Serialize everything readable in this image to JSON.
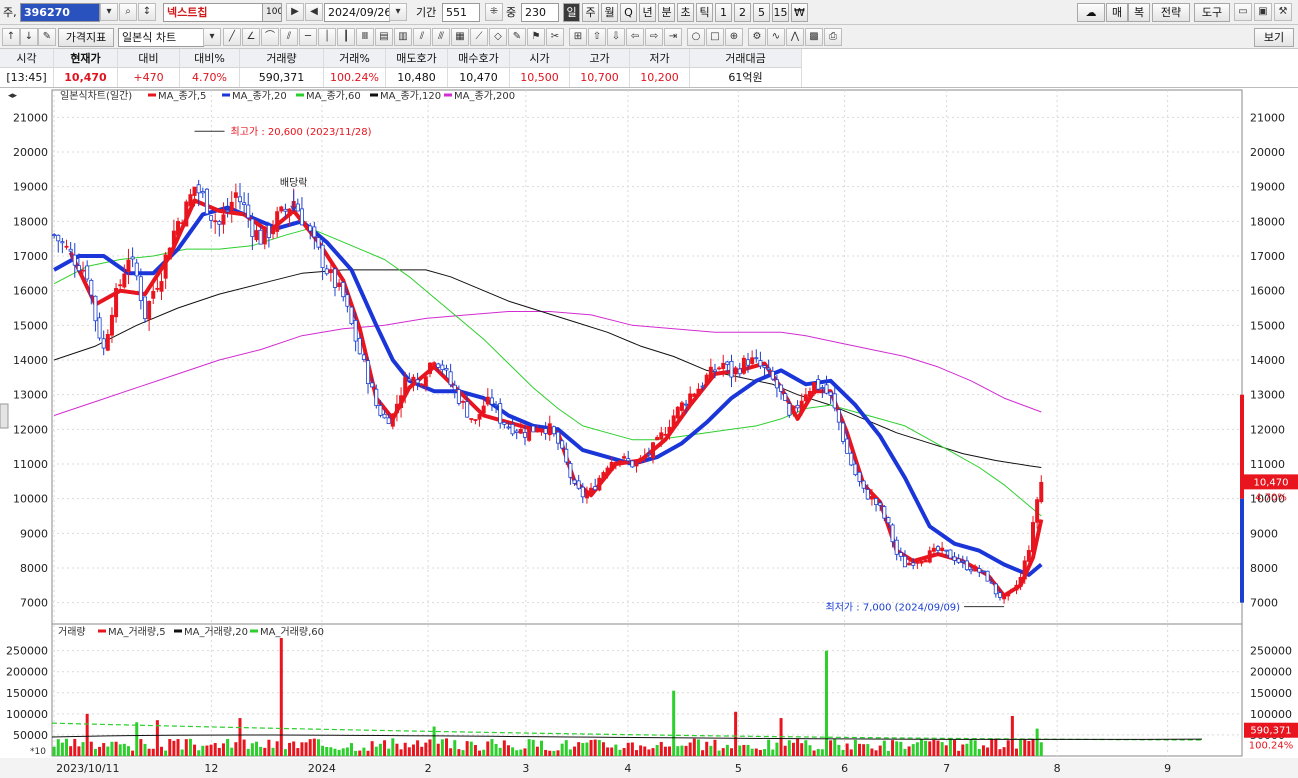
{
  "toolbar": {
    "code_prefix": "주,",
    "code_value": "396270",
    "name": "넥스트칩",
    "name_badge": "100",
    "date": "2024/09/26",
    "period_label": "기간",
    "period_value": "551",
    "zoom_label": "중",
    "zoom_value": "230",
    "intervals": [
      "일",
      "주",
      "월",
      "Q",
      "년",
      "분",
      "초",
      "틱",
      "1",
      "2",
      "5",
      "15",
      "₩"
    ],
    "right_buttons": [
      "매",
      "복",
      "전략",
      "도구"
    ],
    "indicator_button": "가격지표",
    "chart_type": "일본식 차트",
    "view_button": "보기"
  },
  "quote": {
    "headers": [
      "시각",
      "현재가",
      "대비",
      "대비%",
      "거래량",
      "거래%",
      "매도호가",
      "매수호가",
      "시가",
      "고가",
      "저가",
      "거래대금"
    ],
    "values": [
      "[13:45]",
      "10,470",
      "+470",
      "4.70%",
      "590,371",
      "100.24%",
      "10,480",
      "10,470",
      "10,500",
      "10,700",
      "10,200",
      "61억원"
    ]
  },
  "colors": {
    "up": "#e8141e",
    "down": "#1a3fd1",
    "ma5": "#e8141e",
    "ma20": "#1a35d8",
    "ma60": "#2ccf2c",
    "ma120": "#111111",
    "ma200": "#d22cd2",
    "vol_ma5": "#e8141e",
    "vol_ma20": "#111111",
    "vol_ma60": "#2ccf2c"
  },
  "chart_data": {
    "type": "candlestick",
    "title": "일본식차트(일간)",
    "legend": [
      "MA_종가,5",
      "MA_종가,20",
      "MA_종가,60",
      "MA_종가,120",
      "MA_종가,200"
    ],
    "ylim": [
      6500,
      21500
    ],
    "yticks": [
      7000,
      8000,
      9000,
      10000,
      11000,
      12000,
      13000,
      14000,
      15000,
      16000,
      17000,
      18000,
      19000,
      20000,
      21000
    ],
    "month_labels": [
      "2023/10/11",
      "12",
      "2024",
      "2",
      "3",
      "4",
      "5",
      "6",
      "7",
      "8",
      "9"
    ],
    "month_positions": [
      0,
      37,
      63,
      88,
      111,
      135,
      161,
      186,
      210,
      236,
      262
    ],
    "total_bars": 280,
    "close_series": [
      [
        0,
        17600
      ],
      [
        3,
        17200
      ],
      [
        5,
        16900
      ],
      [
        8,
        16500
      ],
      [
        10,
        15200
      ],
      [
        12,
        14300
      ],
      [
        14,
        15500
      ],
      [
        16,
        16200
      ],
      [
        18,
        17000
      ],
      [
        20,
        16400
      ],
      [
        22,
        15300
      ],
      [
        24,
        16000
      ],
      [
        26,
        16500
      ],
      [
        28,
        17400
      ],
      [
        30,
        18000
      ],
      [
        32,
        18400
      ],
      [
        34,
        19000
      ],
      [
        36,
        18700
      ],
      [
        38,
        18200
      ],
      [
        40,
        17900
      ],
      [
        42,
        18300
      ],
      [
        44,
        18800
      ],
      [
        46,
        18400
      ],
      [
        48,
        17800
      ],
      [
        50,
        17500
      ],
      [
        52,
        17700
      ],
      [
        54,
        18100
      ],
      [
        56,
        18300
      ],
      [
        58,
        18600
      ],
      [
        60,
        18100
      ],
      [
        62,
        17600
      ],
      [
        64,
        17100
      ],
      [
        66,
        16600
      ],
      [
        68,
        16200
      ],
      [
        70,
        15800
      ],
      [
        72,
        15000
      ],
      [
        74,
        14200
      ],
      [
        76,
        13500
      ],
      [
        78,
        12700
      ],
      [
        80,
        12300
      ],
      [
        82,
        12400
      ],
      [
        84,
        13100
      ],
      [
        86,
        13600
      ],
      [
        88,
        13300
      ],
      [
        90,
        13700
      ],
      [
        92,
        14100
      ],
      [
        94,
        13800
      ],
      [
        96,
        13300
      ],
      [
        98,
        12900
      ],
      [
        100,
        12500
      ],
      [
        102,
        12200
      ],
      [
        104,
        12700
      ],
      [
        106,
        12800
      ],
      [
        108,
        12300
      ],
      [
        110,
        12100
      ],
      [
        112,
        12000
      ],
      [
        114,
        11900
      ],
      [
        116,
        12000
      ],
      [
        118,
        12100
      ],
      [
        120,
        12000
      ],
      [
        122,
        11600
      ],
      [
        124,
        11000
      ],
      [
        126,
        10300
      ],
      [
        128,
        10100
      ],
      [
        130,
        10200
      ],
      [
        132,
        10600
      ],
      [
        134,
        11000
      ],
      [
        136,
        11200
      ],
      [
        138,
        11100
      ],
      [
        140,
        11000
      ],
      [
        142,
        11100
      ],
      [
        144,
        11300
      ],
      [
        146,
        11600
      ],
      [
        148,
        12000
      ],
      [
        150,
        12400
      ],
      [
        152,
        12700
      ],
      [
        154,
        13000
      ],
      [
        156,
        13200
      ],
      [
        158,
        13500
      ],
      [
        160,
        13700
      ],
      [
        162,
        13900
      ],
      [
        164,
        13600
      ],
      [
        166,
        13800
      ],
      [
        168,
        14000
      ],
      [
        170,
        13900
      ],
      [
        172,
        13700
      ],
      [
        174,
        13400
      ],
      [
        176,
        13000
      ],
      [
        178,
        12300
      ],
      [
        180,
        12700
      ],
      [
        182,
        13100
      ],
      [
        184,
        13300
      ],
      [
        186,
        13200
      ],
      [
        188,
        12900
      ],
      [
        190,
        12200
      ],
      [
        192,
        11300
      ],
      [
        194,
        10700
      ],
      [
        196,
        10200
      ],
      [
        198,
        10000
      ],
      [
        200,
        9700
      ],
      [
        202,
        9200
      ],
      [
        204,
        8400
      ],
      [
        206,
        8100
      ],
      [
        208,
        8200
      ],
      [
        210,
        8300
      ],
      [
        212,
        8400
      ],
      [
        214,
        8500
      ],
      [
        216,
        8400
      ],
      [
        218,
        8300
      ],
      [
        220,
        8100
      ],
      [
        222,
        8000
      ],
      [
        224,
        7900
      ],
      [
        226,
        7700
      ],
      [
        228,
        7300
      ],
      [
        230,
        7100
      ],
      [
        232,
        7300
      ],
      [
        234,
        7700
      ],
      [
        236,
        8600
      ],
      [
        237,
        9200
      ],
      [
        238,
        10000
      ],
      [
        239,
        10470
      ]
    ],
    "ma_series": {
      "MA_종가,5": [
        [
          4,
          17100
        ],
        [
          10,
          15600
        ],
        [
          16,
          16000
        ],
        [
          22,
          15900
        ],
        [
          28,
          17000
        ],
        [
          34,
          18600
        ],
        [
          40,
          18300
        ],
        [
          46,
          18200
        ],
        [
          52,
          17700
        ],
        [
          58,
          18300
        ],
        [
          64,
          17400
        ],
        [
          70,
          16300
        ],
        [
          74,
          14900
        ],
        [
          78,
          12900
        ],
        [
          82,
          12300
        ],
        [
          86,
          13200
        ],
        [
          92,
          13800
        ],
        [
          98,
          13100
        ],
        [
          104,
          12400
        ],
        [
          110,
          12200
        ],
        [
          116,
          12000
        ],
        [
          122,
          11900
        ],
        [
          126,
          10500
        ],
        [
          130,
          10100
        ],
        [
          136,
          11000
        ],
        [
          142,
          11100
        ],
        [
          148,
          11700
        ],
        [
          154,
          12700
        ],
        [
          160,
          13600
        ],
        [
          166,
          13700
        ],
        [
          172,
          13900
        ],
        [
          176,
          13200
        ],
        [
          180,
          12300
        ],
        [
          184,
          13100
        ],
        [
          188,
          13100
        ],
        [
          192,
          11900
        ],
        [
          196,
          10400
        ],
        [
          200,
          9900
        ],
        [
          204,
          8500
        ],
        [
          208,
          8200
        ],
        [
          214,
          8400
        ],
        [
          220,
          8200
        ],
        [
          226,
          7800
        ],
        [
          230,
          7200
        ],
        [
          234,
          7500
        ],
        [
          237,
          8300
        ],
        [
          239,
          9400
        ]
      ],
      "MA_종가,20": [
        [
          0,
          16600
        ],
        [
          6,
          17000
        ],
        [
          12,
          17000
        ],
        [
          18,
          16500
        ],
        [
          24,
          16500
        ],
        [
          30,
          17200
        ],
        [
          36,
          18200
        ],
        [
          42,
          18400
        ],
        [
          48,
          18100
        ],
        [
          54,
          17800
        ],
        [
          60,
          18000
        ],
        [
          66,
          17400
        ],
        [
          72,
          16600
        ],
        [
          78,
          15000
        ],
        [
          82,
          14000
        ],
        [
          86,
          13400
        ],
        [
          92,
          13100
        ],
        [
          98,
          13100
        ],
        [
          104,
          12900
        ],
        [
          110,
          12400
        ],
        [
          116,
          12100
        ],
        [
          122,
          12000
        ],
        [
          128,
          11400
        ],
        [
          134,
          11200
        ],
        [
          140,
          11000
        ],
        [
          146,
          11200
        ],
        [
          152,
          11600
        ],
        [
          158,
          12200
        ],
        [
          164,
          12900
        ],
        [
          170,
          13400
        ],
        [
          176,
          13700
        ],
        [
          182,
          13300
        ],
        [
          188,
          13400
        ],
        [
          194,
          12700
        ],
        [
          200,
          11800
        ],
        [
          206,
          10600
        ],
        [
          212,
          9200
        ],
        [
          218,
          8700
        ],
        [
          224,
          8500
        ],
        [
          230,
          8100
        ],
        [
          236,
          7800
        ],
        [
          239,
          8100
        ]
      ],
      "MA_종가,60": [
        [
          0,
          16200
        ],
        [
          8,
          16700
        ],
        [
          16,
          16900
        ],
        [
          24,
          17000
        ],
        [
          32,
          17200
        ],
        [
          40,
          17200
        ],
        [
          48,
          17300
        ],
        [
          56,
          17600
        ],
        [
          62,
          17800
        ],
        [
          68,
          17500
        ],
        [
          74,
          17200
        ],
        [
          80,
          16900
        ],
        [
          86,
          16400
        ],
        [
          92,
          15800
        ],
        [
          98,
          15200
        ],
        [
          104,
          14600
        ],
        [
          110,
          13900
        ],
        [
          116,
          13200
        ],
        [
          122,
          12600
        ],
        [
          128,
          12100
        ],
        [
          134,
          11900
        ],
        [
          140,
          11700
        ],
        [
          146,
          11700
        ],
        [
          152,
          11800
        ],
        [
          158,
          11900
        ],
        [
          164,
          12000
        ],
        [
          170,
          12100
        ],
        [
          176,
          12300
        ],
        [
          182,
          12600
        ],
        [
          188,
          12700
        ],
        [
          194,
          12500
        ],
        [
          200,
          12300
        ],
        [
          206,
          12100
        ],
        [
          212,
          11700
        ],
        [
          218,
          11300
        ],
        [
          224,
          10900
        ],
        [
          230,
          10400
        ],
        [
          236,
          9800
        ],
        [
          239,
          9500
        ]
      ],
      "MA_종가,120": [
        [
          0,
          14000
        ],
        [
          10,
          14400
        ],
        [
          20,
          15000
        ],
        [
          30,
          15500
        ],
        [
          40,
          15900
        ],
        [
          50,
          16200
        ],
        [
          60,
          16500
        ],
        [
          70,
          16600
        ],
        [
          80,
          16600
        ],
        [
          90,
          16600
        ],
        [
          96,
          16400
        ],
        [
          102,
          16100
        ],
        [
          110,
          15700
        ],
        [
          118,
          15400
        ],
        [
          126,
          15100
        ],
        [
          134,
          14800
        ],
        [
          142,
          14400
        ],
        [
          150,
          14100
        ],
        [
          158,
          13700
        ],
        [
          166,
          13500
        ],
        [
          174,
          13300
        ],
        [
          180,
          13000
        ],
        [
          188,
          12700
        ],
        [
          196,
          12300
        ],
        [
          204,
          11900
        ],
        [
          212,
          11600
        ],
        [
          220,
          11300
        ],
        [
          228,
          11100
        ],
        [
          236,
          10950
        ],
        [
          239,
          10900
        ]
      ],
      "MA_종가,200": [
        [
          0,
          12400
        ],
        [
          10,
          12800
        ],
        [
          20,
          13200
        ],
        [
          30,
          13600
        ],
        [
          40,
          14000
        ],
        [
          50,
          14300
        ],
        [
          60,
          14700
        ],
        [
          70,
          14900
        ],
        [
          80,
          15000
        ],
        [
          90,
          15200
        ],
        [
          100,
          15300
        ],
        [
          110,
          15400
        ],
        [
          120,
          15400
        ],
        [
          130,
          15300
        ],
        [
          140,
          15000
        ],
        [
          150,
          14900
        ],
        [
          160,
          14800
        ],
        [
          170,
          14800
        ],
        [
          176,
          14800
        ],
        [
          182,
          14700
        ],
        [
          190,
          14500
        ],
        [
          198,
          14300
        ],
        [
          206,
          14100
        ],
        [
          214,
          13800
        ],
        [
          222,
          13400
        ],
        [
          230,
          12900
        ],
        [
          239,
          12500
        ]
      ]
    },
    "annotations": {
      "high": "최고가 : 20,600 (2023/11/28)",
      "low": "최저가 : 7,000 (2024/09/09)",
      "dividend": "배당락",
      "current_price": "10,470",
      "current_pct": "4.70%"
    },
    "volume": {
      "title": "거래량",
      "legend": [
        "MA_거래량,5",
        "MA_거래량,20",
        "MA_거래량,60"
      ],
      "ylim": [
        0,
        280000
      ],
      "yticks": [
        50000,
        100000,
        150000,
        200000,
        250000
      ],
      "multiplier": "*10",
      "spikes": [
        [
          8,
          100000
        ],
        [
          20,
          80000
        ],
        [
          25,
          85000
        ],
        [
          45,
          90000
        ],
        [
          55,
          280000
        ],
        [
          62,
          40000
        ],
        [
          92,
          70000
        ],
        [
          150,
          155000
        ],
        [
          165,
          105000
        ],
        [
          176,
          90000
        ],
        [
          187,
          250000
        ],
        [
          232,
          95000
        ],
        [
          238,
          65000
        ]
      ],
      "current_volume": "590,371",
      "current_pct": "100.24%"
    }
  }
}
